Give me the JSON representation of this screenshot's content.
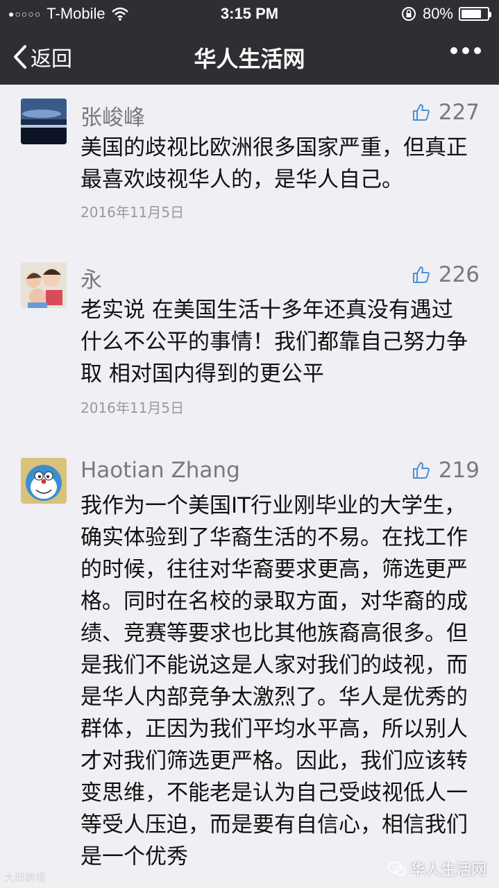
{
  "status": {
    "carrier": "T-Mobile",
    "time": "3:15 PM",
    "battery": "80%",
    "battery_level": 0.8
  },
  "nav": {
    "back_label": "返回",
    "title": "华人生活网"
  },
  "comments": [
    {
      "name": "张峻峰",
      "likes": "227",
      "text": "美国的歧视比欧洲很多国家严重，但真正最喜欢歧视华人的，是华人自己。",
      "date": "2016年11月5日"
    },
    {
      "name": "永",
      "likes": "226",
      "text": "老实说 在美国生活十多年还真没有遇过什么不公平的事情！我们都靠自己努力争取 相对国内得到的更公平",
      "date": "2016年11月5日"
    },
    {
      "name": "Haotian Zhang",
      "likes": "219",
      "text": "我作为一个美国IT行业刚毕业的大学生，确实体验到了华裔生活的不易。在找工作的时候，往往对华裔要求更高，筛选更严格。同时在名校的录取方面，对华裔的成绩、竞赛等要求也比其他族裔高很多。但是我们不能说这是人家对我们的歧视，而是华人内部竞争太激烈了。华人是优秀的群体，正因为我们平均水平高，所以别人才对我们筛选更严格。因此，我们应该转变思维，不能老是认为自己受歧视低人一等受人压迫，而是要有自信心，相信我们是一个优秀"
    }
  ],
  "watermark": {
    "left": "大邸跨境",
    "right": "华人生活网"
  }
}
